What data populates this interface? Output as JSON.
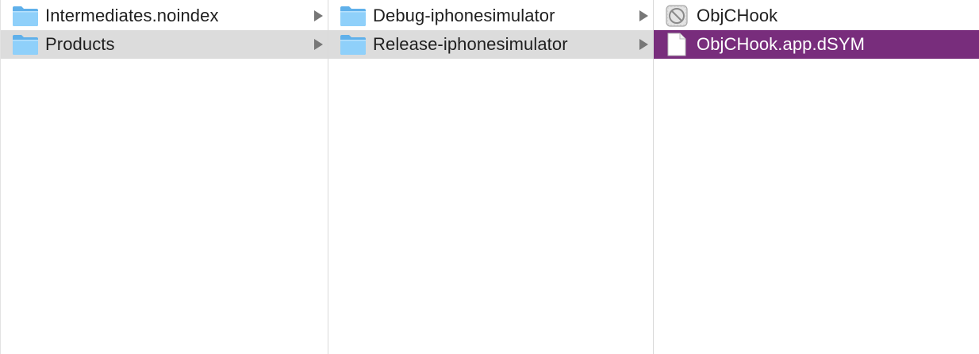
{
  "columns": [
    {
      "items": [
        {
          "label": "Intermediates.noindex",
          "icon": "folder-icon"
        },
        {
          "label": "Products",
          "icon": "folder-icon",
          "state": "path"
        }
      ]
    },
    {
      "items": [
        {
          "label": "Debug-iphonesimulator",
          "icon": "folder-icon"
        },
        {
          "label": "Release-iphonesimulator",
          "icon": "folder-icon",
          "state": "path"
        }
      ]
    },
    {
      "items": [
        {
          "label": "ObjCHook",
          "icon": "app-icon"
        },
        {
          "label": "ObjCHook.app.dSYM",
          "icon": "document-icon",
          "state": "selected"
        }
      ]
    }
  ],
  "colors": {
    "selection": "#782d7c",
    "path_highlight": "#dcdcdc",
    "folder": "#6fbff5",
    "disclosure": "#777777"
  }
}
